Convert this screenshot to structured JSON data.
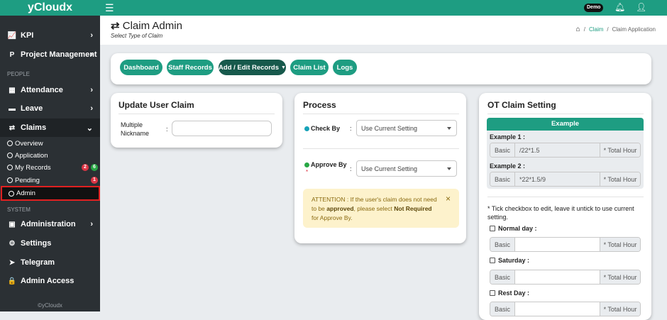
{
  "brand": "yCloudx",
  "topbar": {
    "demo_badge": "Demo"
  },
  "sidebar": {
    "kpi": "KPI",
    "project_management": "Project Management",
    "section_people": "PEOPLE",
    "attendance": "Attendance",
    "leave": "Leave",
    "claims": "Claims",
    "claims_sub": {
      "overview": "Overview",
      "application": "Application",
      "my_records": "My Records",
      "my_records_badge_red": "2",
      "my_records_badge_green": "6",
      "pending": "Pending",
      "pending_badge": "1",
      "admin": "Admin"
    },
    "section_system": "SYSTEM",
    "administration": "Administration",
    "settings": "Settings",
    "telegram": "Telegram",
    "admin_access": "Admin Access",
    "footer": "©yCloudx"
  },
  "page": {
    "title": "Claim Admin",
    "subtitle": "Select Type of Claim",
    "breadcrumb": {
      "claim": "Claim",
      "separator": "/",
      "current": "Claim Application"
    }
  },
  "nav_buttons": {
    "dashboard": "Dashboard",
    "staff_records": "Staff Records",
    "add_edit_records": "Add / Edit Records",
    "claim_list": "Claim List",
    "logs": "Logs"
  },
  "update_user_claim": {
    "title": "Update User Claim",
    "label": "Multiple Nickname",
    "colon": ":",
    "value": ""
  },
  "process": {
    "title": "Process",
    "check_by_label": "Check By",
    "check_by_value": "Use Current Setting",
    "approve_by_label": "Approve By",
    "approve_by_value": "Use Current Setting",
    "required_mark": "*",
    "colon": ":",
    "alert": {
      "text1": "ATTENTION : If the user's claim does not need to be ",
      "bold1": "approved",
      "text2": ", please select ",
      "bold2": "Not Required",
      "text3": " for Approve By.",
      "close": "×"
    }
  },
  "ot": {
    "title": "OT Claim Setting",
    "example_header": "Example",
    "example1_label": "Example 1 :",
    "example1_value": "/22*1.5",
    "example2_label": "Example 2 :",
    "example2_value": "*22*1.5/9",
    "basic": "Basic",
    "total_hour": "* Total Hour",
    "note": "* Tick checkbox to edit, leave it untick to use current setting.",
    "normal_day": "Normal day :",
    "saturday": "Saturday :",
    "rest_day": "Rest Day :"
  },
  "colors": {
    "primary": "#1e9d82",
    "dark_button": "#17594c",
    "sidebar": "#2b3034",
    "alert_bg": "#fdf2cc",
    "alert_text": "#8a6a10",
    "badge_red": "#dc3545",
    "badge_green": "#28a745",
    "highlight": "#e02020"
  }
}
